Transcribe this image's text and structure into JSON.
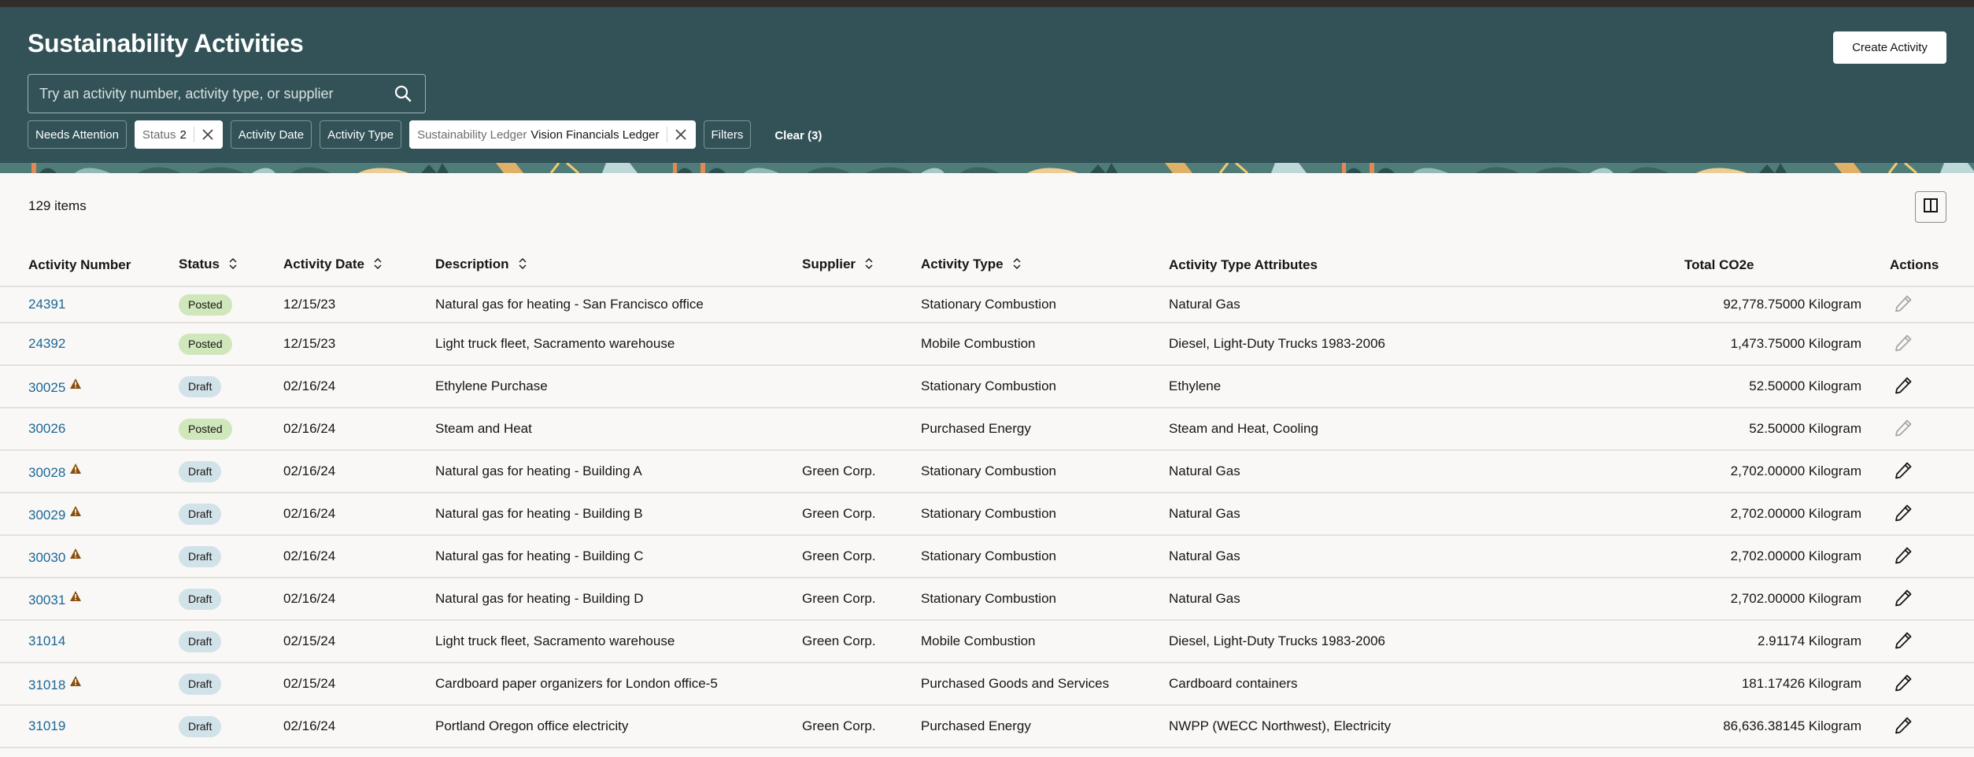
{
  "header": {
    "title": "Sustainability Activities",
    "create_button": "Create Activity",
    "search": {
      "placeholder": "Try an activity number, activity type, or supplier",
      "value": "",
      "icon": "search-icon"
    },
    "filters": [
      {
        "label": "Needs Attention",
        "active": false
      },
      {
        "label": "Status",
        "value": "2",
        "active": true,
        "removable": true
      },
      {
        "label": "Activity Date",
        "active": false
      },
      {
        "label": "Activity Type",
        "active": false
      },
      {
        "label": "Sustainability Ledger",
        "value": "Vision Financials Ledger",
        "active": true,
        "removable": true
      },
      {
        "label": "Filters",
        "active": false
      }
    ],
    "clear_label": "Clear (3)"
  },
  "list": {
    "count_label": "129 items",
    "column_toggle_icon": "columns-icon",
    "columns": [
      {
        "label": "Activity Number",
        "sortable": false
      },
      {
        "label": "Status",
        "sortable": true
      },
      {
        "label": "Activity Date",
        "sortable": true
      },
      {
        "label": "Description",
        "sortable": true
      },
      {
        "label": "Supplier",
        "sortable": true
      },
      {
        "label": "Activity Type",
        "sortable": true
      },
      {
        "label": "Activity Type Attributes",
        "sortable": false
      },
      {
        "label": "Total CO2e",
        "sortable": false
      },
      {
        "label": "Actions",
        "sortable": false
      }
    ],
    "rows": [
      {
        "number": "24391",
        "warning": false,
        "status": "Posted",
        "date": "12/15/23",
        "description": "Natural gas for heating - San Francisco office",
        "supplier": "",
        "type": "Stationary Combustion",
        "attributes": "Natural Gas",
        "co2e": "92,778.75000 Kilogram",
        "editable": false
      },
      {
        "number": "24392",
        "warning": false,
        "status": "Posted",
        "date": "12/15/23",
        "description": "Light truck fleet, Sacramento warehouse",
        "supplier": "",
        "type": "Mobile Combustion",
        "attributes": "Diesel, Light-Duty Trucks 1983-2006",
        "co2e": "1,473.75000 Kilogram",
        "editable": false
      },
      {
        "number": "30025",
        "warning": true,
        "status": "Draft",
        "date": "02/16/24",
        "description": "Ethylene Purchase",
        "supplier": "",
        "type": "Stationary Combustion",
        "attributes": "Ethylene",
        "co2e": "52.50000 Kilogram",
        "editable": true
      },
      {
        "number": "30026",
        "warning": false,
        "status": "Posted",
        "date": "02/16/24",
        "description": "Steam and Heat",
        "supplier": "",
        "type": "Purchased Energy",
        "attributes": "Steam and Heat, Cooling",
        "co2e": "52.50000 Kilogram",
        "editable": false
      },
      {
        "number": "30028",
        "warning": true,
        "status": "Draft",
        "date": "02/16/24",
        "description": "Natural gas for heating - Building A",
        "supplier": "Green Corp.",
        "type": "Stationary Combustion",
        "attributes": "Natural Gas",
        "co2e": "2,702.00000 Kilogram",
        "editable": true
      },
      {
        "number": "30029",
        "warning": true,
        "status": "Draft",
        "date": "02/16/24",
        "description": "Natural gas for heating - Building B",
        "supplier": "Green Corp.",
        "type": "Stationary Combustion",
        "attributes": "Natural Gas",
        "co2e": "2,702.00000 Kilogram",
        "editable": true
      },
      {
        "number": "30030",
        "warning": true,
        "status": "Draft",
        "date": "02/16/24",
        "description": "Natural gas for heating - Building C",
        "supplier": "Green Corp.",
        "type": "Stationary Combustion",
        "attributes": "Natural Gas",
        "co2e": "2,702.00000 Kilogram",
        "editable": true
      },
      {
        "number": "30031",
        "warning": true,
        "status": "Draft",
        "date": "02/16/24",
        "description": "Natural gas for heating - Building D",
        "supplier": "Green Corp.",
        "type": "Stationary Combustion",
        "attributes": "Natural Gas",
        "co2e": "2,702.00000 Kilogram",
        "editable": true
      },
      {
        "number": "31014",
        "warning": false,
        "status": "Draft",
        "date": "02/15/24",
        "description": "Light truck fleet, Sacramento warehouse",
        "supplier": "Green Corp.",
        "type": "Mobile Combustion",
        "attributes": "Diesel, Light-Duty Trucks 1983-2006",
        "co2e": "2.91174 Kilogram",
        "editable": true
      },
      {
        "number": "31018",
        "warning": true,
        "status": "Draft",
        "date": "02/15/24",
        "description": "Cardboard paper organizers for London office-5",
        "supplier": "",
        "type": "Purchased Goods and Services",
        "attributes": "Cardboard containers",
        "co2e": "181.17426 Kilogram",
        "editable": true
      },
      {
        "number": "31019",
        "warning": false,
        "status": "Draft",
        "date": "02/16/24",
        "description": "Portland Oregon office electricity",
        "supplier": "Green Corp.",
        "type": "Purchased Energy",
        "attributes": "NWPP (WECC Northwest), Electricity",
        "co2e": "86,636.38145 Kilogram",
        "editable": true
      }
    ]
  },
  "colors": {
    "header_bg": "#325257",
    "link": "#1a6796",
    "posted_badge": "#d0e6bb",
    "draft_badge": "#d2e2e9",
    "warning": "#8a4e0b"
  }
}
